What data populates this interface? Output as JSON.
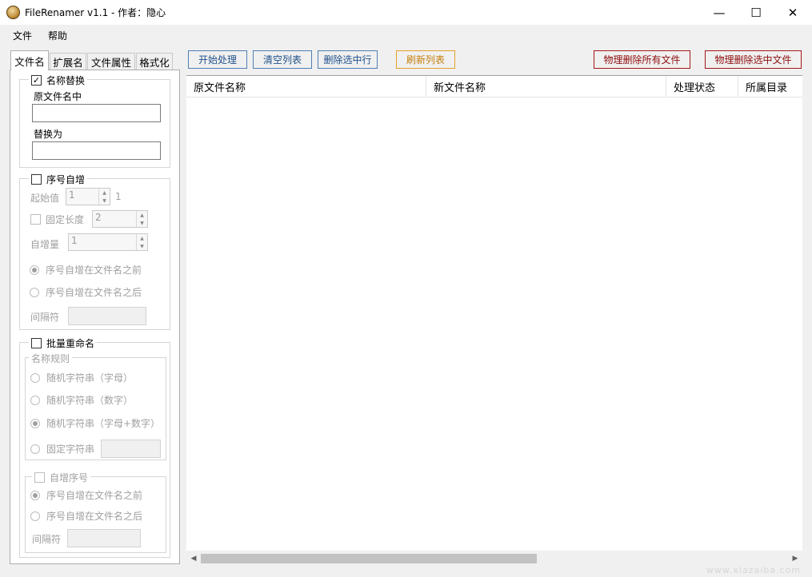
{
  "window": {
    "title": "FileRenamer v1.1 - 作者：隐心",
    "minimize": "—",
    "maximize": "☐",
    "close": "✕"
  },
  "menu": {
    "file": "文件",
    "help": "帮助"
  },
  "tabs": [
    "文件名",
    "扩展名",
    "文件属性",
    "格式化"
  ],
  "name_replace": {
    "label": "名称替换",
    "checked": true,
    "source_label": "原文件名中",
    "source_value": "",
    "target_label": "替换为",
    "target_value": ""
  },
  "seq_increment": {
    "label": "序号自增",
    "checked": false,
    "start_label": "起始值",
    "start_value": "1",
    "start_preview": "1",
    "fixed_len_label": "固定长度",
    "fixed_len_value": "2",
    "step_label": "自增量",
    "step_value": "1",
    "before_label": "序号自增在文件名之前",
    "after_label": "序号自增在文件名之后",
    "separator_label": "间隔符"
  },
  "batch_rename": {
    "label": "批量重命名",
    "checked": false,
    "rule_label": "名称规则",
    "rule_letters": "随机字符串（字母）",
    "rule_digits": "随机字符串（数字）",
    "rule_mixed": "随机字符串（字母+数字）",
    "rule_fixed": "固定字符串",
    "auto_seq_label": "自增序号",
    "before_label": "序号自增在文件名之前",
    "after_label": "序号自增在文件名之后",
    "separator_label": "间隔符"
  },
  "toolbar": {
    "start": "开始处理",
    "clear": "清空列表",
    "delete_selected_rows": "删除选中行",
    "refresh": "刷新列表",
    "delete_all_files": "物理删除所有文件",
    "delete_selected_files": "物理删除选中文件"
  },
  "columns": [
    "原文件名称",
    "新文件名称",
    "处理状态",
    "所属目录"
  ],
  "watermark": "www.xiazaiba.com"
}
